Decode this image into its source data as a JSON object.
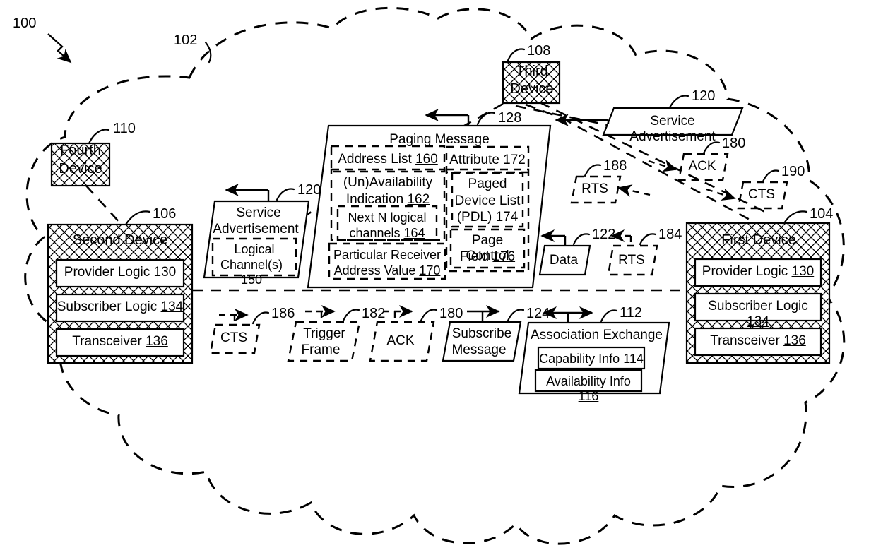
{
  "figure": {
    "figure_ref": "100",
    "cloud_ref": "102"
  },
  "devices": [
    {
      "id": "first-device",
      "title": "First Device",
      "ref": "104",
      "components": [
        {
          "label": "Provider Logic",
          "ref": "130"
        },
        {
          "label": "Subscriber Logic",
          "ref": "134"
        },
        {
          "label": "Transceiver",
          "ref": "136"
        }
      ]
    },
    {
      "id": "second-device",
      "title": "Second Device",
      "ref": "106",
      "components": [
        {
          "label": "Provider Logic",
          "ref": "130"
        },
        {
          "label": "Subscriber Logic",
          "ref": "134"
        },
        {
          "label": "Transceiver",
          "ref": "136"
        }
      ]
    },
    {
      "id": "third-device",
      "title_line1": "Third",
      "title_line2": "Device",
      "ref": "108"
    },
    {
      "id": "fourth-device",
      "title_line1": "Fourth",
      "title_line2": "Device",
      "ref": "110"
    }
  ],
  "paging_message": {
    "title": "Paging Message",
    "ref": "128",
    "fields": [
      {
        "label": "Address List",
        "ref": "160"
      },
      {
        "label": "(Un)Availability Indication",
        "ref": "162"
      },
      {
        "label": "Next N logical channels",
        "ref": "164"
      },
      {
        "label": "Particular Receiver Address Value",
        "ref": "170"
      },
      {
        "label": "Attribute",
        "ref": "172"
      },
      {
        "label": "Paged Device List (PDL)",
        "ref": "174"
      },
      {
        "label": "Page Control Field",
        "ref": "176"
      }
    ],
    "field_text": {
      "address_list": "Address List",
      "address_list_ref": "160",
      "unavail_line1": "(Un)Availability",
      "unavail_line2": "Indication",
      "unavail_ref": "162",
      "nextn_line1": "Next N logical",
      "nextn_line2": "channels",
      "nextn_ref": "164",
      "particular_line1": "Particular Receiver",
      "particular_line2": "Address Value",
      "particular_ref": "170",
      "attribute": "Attribute",
      "attribute_ref": "172",
      "pdl_line1": "Paged",
      "pdl_line2": "Device List",
      "pdl_line3": "(PDL)",
      "pdl_ref": "174",
      "pcf_line1": "Page Control",
      "pcf_line2": "Field",
      "pcf_ref": "176"
    }
  },
  "service_advertisement_left": {
    "line1": "Service",
    "line2": "Advertisement",
    "ref": "120",
    "inner_line1": "Logical",
    "inner_line2": "Channel(s)",
    "inner_ref": "150"
  },
  "service_advertisement_right": {
    "label": "Service Advertisement",
    "ref": "120"
  },
  "association_exchange": {
    "title": "Association Exchange",
    "ref": "112",
    "items": [
      {
        "label": "Capability Info",
        "ref": "114"
      },
      {
        "label": "Availability Info",
        "ref": "116"
      }
    ]
  },
  "messages": [
    {
      "id": "data-msg",
      "label": "Data",
      "ref": "122",
      "style": "solid"
    },
    {
      "id": "rts-184",
      "label": "RTS",
      "ref": "184",
      "style": "dashed"
    },
    {
      "id": "rts-188",
      "label": "RTS",
      "ref": "188",
      "style": "dashed"
    },
    {
      "id": "ack-180-top",
      "label": "ACK",
      "ref": "180",
      "style": "dashed"
    },
    {
      "id": "cts-190",
      "label": "CTS",
      "ref": "190",
      "style": "dashed"
    },
    {
      "id": "cts-186",
      "label": "CTS",
      "ref": "186",
      "style": "dashed"
    },
    {
      "id": "trigger-frame-182",
      "label_line1": "Trigger",
      "label_line2": "Frame",
      "ref": "182",
      "style": "dashed"
    },
    {
      "id": "ack-180-bottom",
      "label": "ACK",
      "ref": "180",
      "style": "dashed"
    },
    {
      "id": "subscribe-124",
      "label_line1": "Subscribe",
      "label_line2": "Message",
      "ref": "124",
      "style": "solid"
    }
  ],
  "msg_text": {
    "data": "Data",
    "data_ref": "122",
    "rts_184": "RTS",
    "rts_184_ref": "184",
    "rts_188": "RTS",
    "rts_188_ref": "188",
    "ack_top": "ACK",
    "ack_top_ref": "180",
    "cts_190": "CTS",
    "cts_190_ref": "190",
    "cts_186": "CTS",
    "cts_186_ref": "186",
    "trigger_l1": "Trigger",
    "trigger_l2": "Frame",
    "trigger_ref": "182",
    "ack_bottom": "ACK",
    "ack_bottom_ref": "180",
    "subscribe_l1": "Subscribe",
    "subscribe_l2": "Message",
    "subscribe_ref": "124"
  },
  "colors": {
    "stroke": "#000000",
    "background": "#ffffff"
  }
}
